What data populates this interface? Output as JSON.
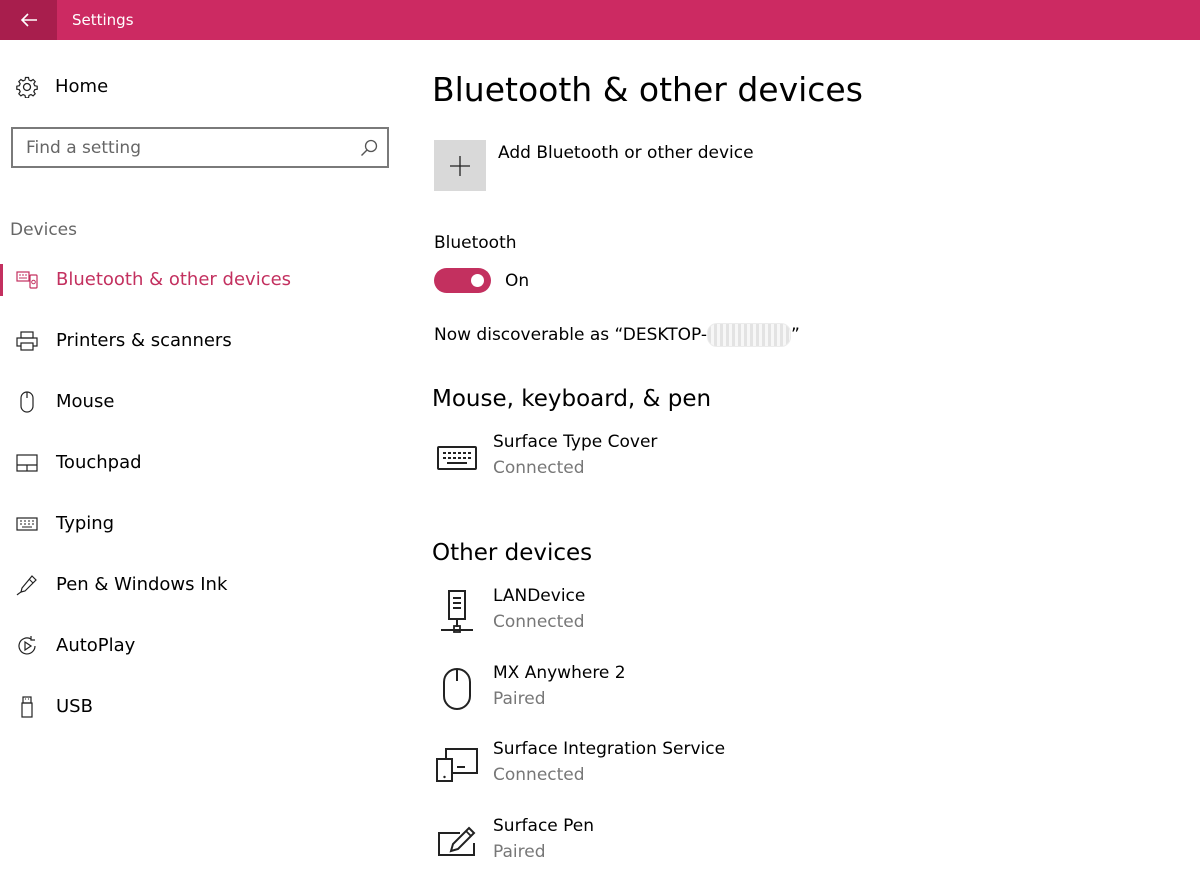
{
  "window": {
    "title": "Settings",
    "accent": "#cc2a62"
  },
  "sidebar": {
    "home_label": "Home",
    "search": {
      "placeholder": "Find a setting"
    },
    "section_title": "Devices",
    "items": [
      {
        "label": "Bluetooth & other devices",
        "icon": "bluetooth-devices-icon",
        "selected": true
      },
      {
        "label": "Printers & scanners",
        "icon": "printer-icon"
      },
      {
        "label": "Mouse",
        "icon": "mouse-icon"
      },
      {
        "label": "Touchpad",
        "icon": "touchpad-icon"
      },
      {
        "label": "Typing",
        "icon": "keyboard-icon"
      },
      {
        "label": "Pen & Windows Ink",
        "icon": "pen-icon"
      },
      {
        "label": "AutoPlay",
        "icon": "autoplay-icon"
      },
      {
        "label": "USB",
        "icon": "usb-icon"
      }
    ]
  },
  "main": {
    "title": "Bluetooth & other devices",
    "add_device_label": "Add Bluetooth or other device",
    "bluetooth": {
      "label": "Bluetooth",
      "state": "On",
      "enabled": true
    },
    "discoverable_text": "Now discoverable as “DESKTOP-",
    "discoverable_suffix": "”",
    "mouse_keyboard_pen": {
      "heading": "Mouse, keyboard, & pen",
      "devices": [
        {
          "name": "Surface Type Cover",
          "status": "Connected",
          "icon": "keyboard-icon"
        }
      ]
    },
    "other_devices": {
      "heading": "Other devices",
      "devices": [
        {
          "name": "LANDevice",
          "status": "Connected",
          "icon": "network-device-icon"
        },
        {
          "name": "MX Anywhere 2",
          "status": "Paired",
          "icon": "mouse-icon"
        },
        {
          "name": "Surface Integration Service",
          "status": "Connected",
          "icon": "devices-icon"
        },
        {
          "name": "Surface Pen",
          "status": "Paired",
          "icon": "pen-tablet-icon"
        }
      ]
    }
  }
}
